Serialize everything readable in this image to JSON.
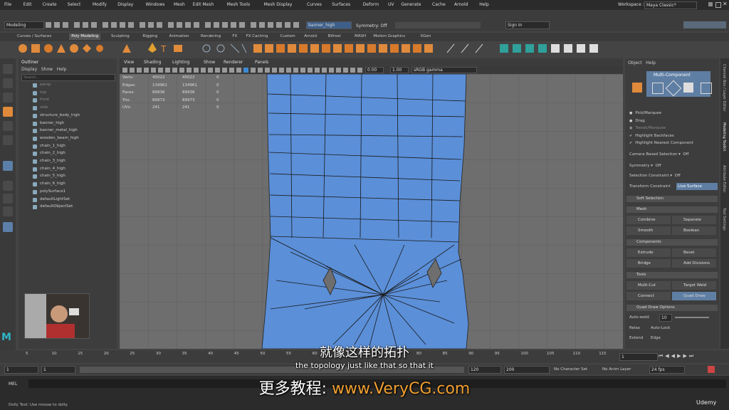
{
  "menubar": {
    "items": [
      "File",
      "Edit",
      "Create",
      "Select",
      "Modify",
      "Display",
      "Windows",
      "Mesh",
      "Edit Mesh",
      "Mesh Tools",
      "Mesh Display",
      "Curves",
      "Surfaces",
      "Deform",
      "UV",
      "Generate",
      "Cache",
      "Arnold",
      "Help"
    ],
    "workspace_label": "Workspace :",
    "workspace_value": "Maya Classic*"
  },
  "statusline": {
    "mode": "Modeling",
    "object_field": "banner_high",
    "symmetry": "Symmetry: Off",
    "sign_in": "Sign In"
  },
  "shelf": {
    "tabs": [
      "Curves / Surfaces",
      "Poly Modeling",
      "Sculpting",
      "Rigging",
      "Animation",
      "Rendering",
      "FX",
      "FX Caching",
      "Custom",
      "Arnold",
      "Bifrost",
      "MASH",
      "Motion Graphics",
      "XGen"
    ],
    "active_tab": "Poly Modeling"
  },
  "outliner": {
    "title": "Outliner",
    "menu": [
      "Display",
      "Show",
      "Help"
    ],
    "search_placeholder": "Search...",
    "items": [
      "persp",
      "top",
      "front",
      "side",
      "structure_body_high",
      "banner_high",
      "banner_metal_high",
      "wooden_beam_high",
      "chain_1_high",
      "chain_2_high",
      "chain_3_high",
      "chain_4_high",
      "chain_5_high",
      "chain_6_high",
      "polySurface1",
      "defaultLightSet",
      "defaultObjectSet"
    ]
  },
  "viewport": {
    "menu": [
      "View",
      "Shading",
      "Lighting",
      "Show",
      "Renderer",
      "Panels"
    ],
    "exposure": "0.00",
    "gamma": "1.00",
    "colorspace": "sRGB gamma",
    "hud": [
      {
        "label": "Verts:",
        "a": "45022",
        "b": "45022",
        "c": "0"
      },
      {
        "label": "Edges:",
        "a": "134961",
        "b": "134961",
        "c": "0"
      },
      {
        "label": "Faces:",
        "a": "89936",
        "b": "89936",
        "c": "0"
      },
      {
        "label": "Tris:",
        "a": "89973",
        "b": "89973",
        "c": "0"
      },
      {
        "label": "UVs:",
        "a": "241",
        "b": "241",
        "c": "0"
      }
    ]
  },
  "modeling_toolkit": {
    "menu": [
      "Object",
      "Help"
    ],
    "multi_component": "Multi-Component",
    "options": [
      "Pick/Marquee",
      "Drag",
      "Tweak/Marquee",
      "Highlight Backfaces",
      "Highlight Nearest Component"
    ],
    "camera_based": "Camera Based Selection",
    "camera_based_val": "Off",
    "symmetry": "Symmetry",
    "symmetry_val": "Off",
    "selection_constraint": "Selection Constraint",
    "selection_constraint_val": "Off",
    "transform_constraint": "Transform Constraint",
    "transform_constraint_val": "Live Surface",
    "soft_selection": "Soft Selection",
    "mesh_header": "Mesh",
    "mesh_buttons": [
      "Combine",
      "Separate",
      "Smooth",
      "Boolean"
    ],
    "components_header": "Components",
    "component_buttons": [
      "Extrude",
      "Bevel",
      "Bridge",
      "Add Divisions"
    ],
    "tools_header": "Tools",
    "tool_buttons": [
      "Multi-Cut",
      "Target Weld",
      "Connect",
      "Quad Draw"
    ],
    "quad_draw_header": "Quad Draw Options",
    "auto_weld": "Auto-weld",
    "auto_weld_val": "10",
    "relax": "Relax",
    "relax_val": "Auto-Lock",
    "extend": "Extend",
    "extend_val": "Edge",
    "side_tabs": [
      "Channel Box / Layer Editor",
      "Modeling Toolkit",
      "Attribute Editor",
      "Tool Settings"
    ]
  },
  "timeline": {
    "ticks": [
      "5",
      "10",
      "15",
      "20",
      "25",
      "30",
      "35",
      "40",
      "45",
      "50",
      "55",
      "60",
      "65",
      "70",
      "75",
      "80",
      "85",
      "90",
      "95",
      "100",
      "105",
      "110",
      "115"
    ],
    "current_frame": "1"
  },
  "range": {
    "start": "1",
    "start2": "1",
    "end": "120",
    "end2": "120",
    "max": "200",
    "character_set": "No Character Set",
    "anim_layer": "No Anim Layer",
    "fps": "24 fps"
  },
  "command": {
    "lang": "MEL",
    "help_line": "Dolly Tool: Use mouse to dolly."
  },
  "subtitles": {
    "chinese": "就像这样的拓扑",
    "english": "the topology just like that so that it",
    "promo_cn": "更多教程:",
    "promo_url": "www.VeryCG.com"
  },
  "watermark": "Udemy"
}
